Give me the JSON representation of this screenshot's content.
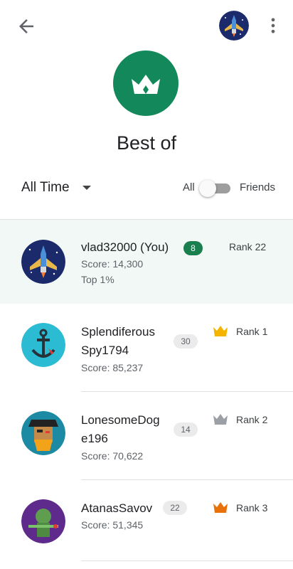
{
  "header": {
    "title": "Best of"
  },
  "filters": {
    "time_label": "All Time",
    "toggle_all_label": "All",
    "toggle_friends_label": "Friends",
    "toggle_on": false
  },
  "players": [
    {
      "name": "vlad32000 (You)",
      "level": "8",
      "score": "Score: 14,300",
      "extra": "Top 1%",
      "rank": "Rank 22",
      "is_you": true
    },
    {
      "name_lines": [
        "Splendiferous",
        "Spy1794"
      ],
      "level": "30",
      "score": "Score: 85,237",
      "rank": "Rank 1",
      "crown_color": "#f5b400"
    },
    {
      "name_lines": [
        "LonesomeDog",
        "e196"
      ],
      "level": "14",
      "score": "Score: 70,622",
      "rank": "Rank 2",
      "crown_color": "#9aa0a6"
    },
    {
      "name": "AtanasSavov",
      "level": "22",
      "score": "Score: 51,345",
      "rank": "Rank 3",
      "crown_color": "#e8710a"
    }
  ],
  "colors": {
    "brand_green": "#13895b",
    "you_row_bg": "#f1f8f5"
  },
  "icons": {
    "back": "arrow-left-icon",
    "more": "more-vert-icon",
    "crown": "crown-icon"
  }
}
